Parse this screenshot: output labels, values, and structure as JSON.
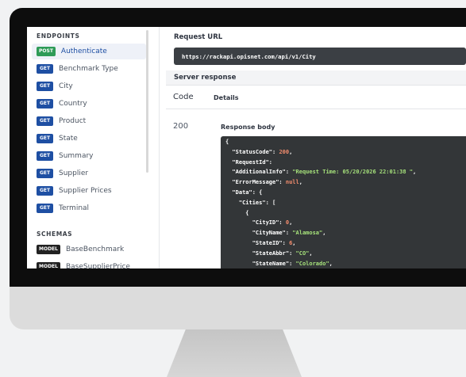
{
  "sidebar": {
    "endpoints_title": "ENDPOINTS",
    "endpoints": [
      {
        "method": "POST",
        "label": "Authenticate",
        "active": true
      },
      {
        "method": "GET",
        "label": "Benchmark Type"
      },
      {
        "method": "GET",
        "label": "City"
      },
      {
        "method": "GET",
        "label": "Country"
      },
      {
        "method": "GET",
        "label": "Product"
      },
      {
        "method": "GET",
        "label": "State"
      },
      {
        "method": "GET",
        "label": "Summary"
      },
      {
        "method": "GET",
        "label": "Supplier"
      },
      {
        "method": "GET",
        "label": "Supplier Prices"
      },
      {
        "method": "GET",
        "label": "Terminal"
      }
    ],
    "schemas_title": "SCHEMAS",
    "schemas": [
      {
        "badge": "MODEL",
        "label": "BaseBenchmark"
      },
      {
        "badge": "MODEL",
        "label": "BaseSupplierPrice"
      }
    ]
  },
  "main": {
    "request_url_label": "Request URL",
    "request_url": "https://rackapi.opisnet.com/api/v1/City",
    "server_response_label": "Server response",
    "code_header": "Code",
    "details_header": "Details",
    "status_code": "200",
    "response_body_label": "Response body",
    "response_body": [
      [
        {
          "t": "{",
          "c": "p"
        }
      ],
      [
        {
          "t": "  \"StatusCode\": ",
          "c": "k"
        },
        {
          "t": "200",
          "c": "n"
        },
        {
          "t": ",",
          "c": "p"
        }
      ],
      [
        {
          "t": "  \"RequestId\":",
          "c": "k"
        }
      ],
      [
        {
          "t": "  \"AdditionalInfo\": ",
          "c": "k"
        },
        {
          "t": "\"Request Time: 05/20/2026 22:01:38 \"",
          "c": "s"
        },
        {
          "t": ",",
          "c": "p"
        }
      ],
      [
        {
          "t": "  \"ErrorMessage\": ",
          "c": "k"
        },
        {
          "t": "null",
          "c": "n"
        },
        {
          "t": ",",
          "c": "p"
        }
      ],
      [
        {
          "t": "  \"Data\": {",
          "c": "k"
        }
      ],
      [
        {
          "t": "    \"Cities\": [",
          "c": "k"
        }
      ],
      [
        {
          "t": "      {",
          "c": "p"
        }
      ],
      [
        {
          "t": "        \"CityID\": ",
          "c": "k"
        },
        {
          "t": "0",
          "c": "n"
        },
        {
          "t": ",",
          "c": "p"
        }
      ],
      [
        {
          "t": "        \"CityName\": ",
          "c": "k"
        },
        {
          "t": "\"Alamosa\"",
          "c": "s"
        },
        {
          "t": ",",
          "c": "p"
        }
      ],
      [
        {
          "t": "        \"StateID\": ",
          "c": "k"
        },
        {
          "t": "6",
          "c": "n"
        },
        {
          "t": ",",
          "c": "p"
        }
      ],
      [
        {
          "t": "        \"StateAbbr\": ",
          "c": "k"
        },
        {
          "t": "\"CO\"",
          "c": "s"
        },
        {
          "t": ",",
          "c": "p"
        }
      ],
      [
        {
          "t": "        \"StateName\": ",
          "c": "k"
        },
        {
          "t": "\"Colorado\"",
          "c": "s"
        },
        {
          "t": ",",
          "c": "p"
        }
      ]
    ]
  }
}
